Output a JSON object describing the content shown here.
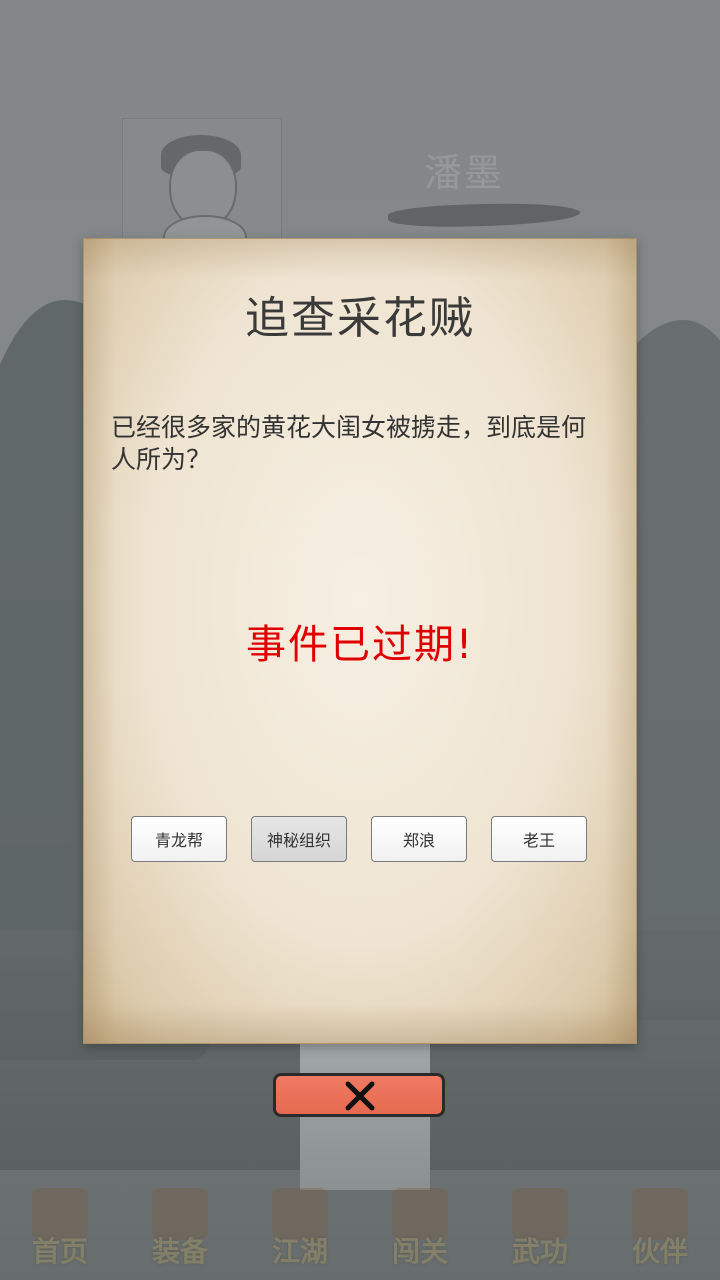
{
  "character": {
    "name": "潘墨"
  },
  "dialog": {
    "title": "追查采花贼",
    "body": "已经很多家的黄花大闺女被掳走，到底是何人所为？",
    "status": "事件已过期!",
    "options": [
      {
        "label": "青龙帮",
        "selected": false
      },
      {
        "label": "神秘组织",
        "selected": true
      },
      {
        "label": "郑浪",
        "selected": false
      },
      {
        "label": "老王",
        "selected": false
      }
    ],
    "close_icon": "close-x-icon"
  },
  "bottom_nav": {
    "items": [
      {
        "label": "首页",
        "icon": "gate-icon"
      },
      {
        "label": "装备",
        "icon": "armor-icon"
      },
      {
        "label": "江湖",
        "icon": "map-icon"
      },
      {
        "label": "闯关",
        "icon": "sword-icon"
      },
      {
        "label": "武功",
        "icon": "book-icon"
      },
      {
        "label": "伙伴",
        "icon": "partners-icon"
      }
    ]
  },
  "colors": {
    "expired_text": "#e00000",
    "close_button": "#ea6f55"
  }
}
